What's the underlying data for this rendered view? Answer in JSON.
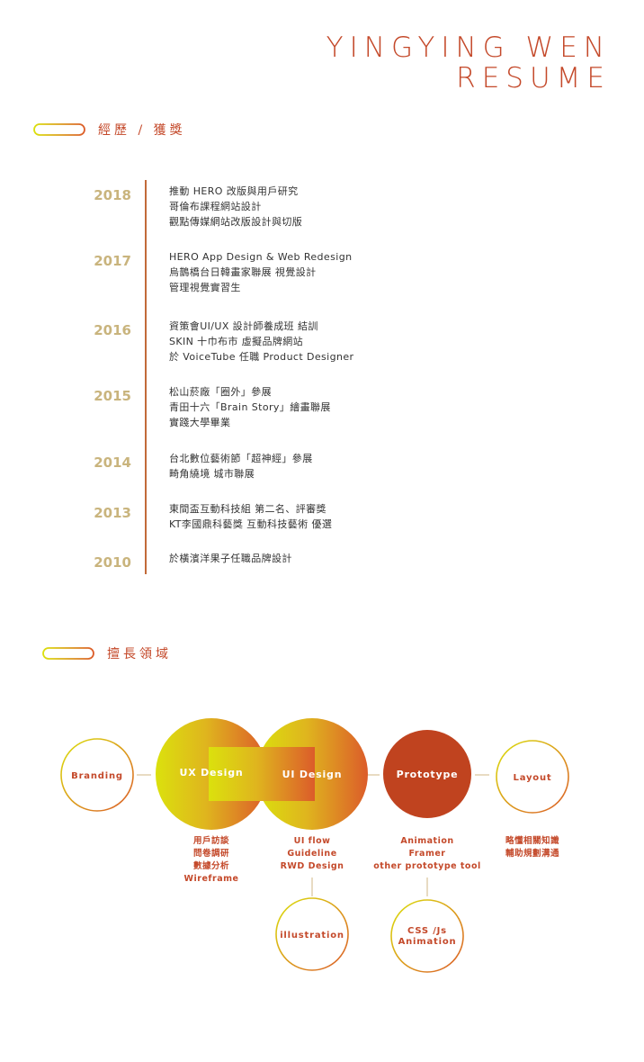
{
  "header": {
    "name": "YINGYING WEN",
    "subtitle": "RESUME"
  },
  "colors": {
    "accent": "#c4492a",
    "year": "#c9b47d",
    "timeline": "#c26a39",
    "gradient_start": "#dbe10d",
    "gradient_end": "#dc5c2a",
    "prototype_fill": "#c0431f"
  },
  "experience": {
    "heading": "經歷 / 獲獎",
    "entries": [
      {
        "year": "2018",
        "lines": [
          "推動 HERO 改版與用戶研究",
          "哥倫布課程網站設計",
          "觀點傳媒網站改版設計與切版"
        ]
      },
      {
        "year": "2017",
        "lines": [
          "HERO App Design & Web Redesign",
          "烏鵲橋台日韓畫家聯展 視覺設計",
          "管理視覺實習生"
        ]
      },
      {
        "year": "2016",
        "lines": [
          "資策會UI/UX 設計師養成班 結訓",
          "SKIN 十巾布市 虛擬品牌網站",
          "於 VoiceTube 任職 Product Designer"
        ]
      },
      {
        "year": "2015",
        "lines": [
          "松山菸廠「圈外」參展",
          "青田十六「Brain Story」繪畫聯展",
          "實踐大學畢業"
        ]
      },
      {
        "year": "2014",
        "lines": [
          "台北數位藝術節「超神經」參展",
          "畸角繞境 城市聯展"
        ]
      },
      {
        "year": "2013",
        "lines": [
          "東間盃互動科技組 第二名、評審獎",
          "KT李國鼎科藝獎 互動科技藝術 優選"
        ]
      },
      {
        "year": "2010",
        "lines": [
          "於橫濱洋果子任職品牌設計"
        ]
      }
    ]
  },
  "skills": {
    "heading": "擅長領域",
    "nodes": {
      "branding": "Branding",
      "ux": "UX Design",
      "ui": "UI Design",
      "prototype": "Prototype",
      "layout": "Layout",
      "illustration": "illustration",
      "css_line1": "CSS /Js",
      "css_line2": "Animation"
    },
    "ux_items": [
      "用戶訪談",
      "問卷調研",
      "數據分析",
      "Wireframe"
    ],
    "ui_items": [
      "UI flow",
      "Guideline",
      "RWD Design"
    ],
    "prototype_items": [
      "Animation",
      "Framer",
      "other prototype tool"
    ],
    "layout_items": [
      "略懂相關知識",
      "輔助規劃溝通"
    ]
  }
}
